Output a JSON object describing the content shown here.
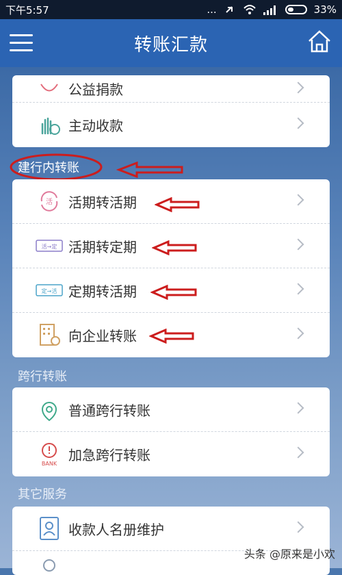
{
  "status": {
    "time": "下午5:57",
    "dots": "...",
    "battery": "33%"
  },
  "header": {
    "title": "转账汇款"
  },
  "top_card": [
    {
      "label": "公益捐款"
    },
    {
      "label": "主动收款"
    }
  ],
  "section1": {
    "title": "建行内转账"
  },
  "card1": [
    {
      "label": "活期转活期",
      "icon_text": "活"
    },
    {
      "label": "活期转定期",
      "icon_text": "活→定"
    },
    {
      "label": "定期转活期",
      "icon_text": "定→活"
    },
    {
      "label": "向企业转账"
    }
  ],
  "section2": {
    "title": "跨行转账"
  },
  "card2": [
    {
      "label": "普通跨行转账"
    },
    {
      "label": "加急跨行转账",
      "icon_text": "BANK"
    }
  ],
  "section3": {
    "title": "其它服务"
  },
  "card3": [
    {
      "label": "收款人名册维护"
    }
  ],
  "watermark": {
    "text": "头条 @原来是小欢"
  },
  "colors": {
    "header": "#2b64b3",
    "accent_red": "#cc1d1d",
    "statusbar": "#0f1b2e"
  }
}
